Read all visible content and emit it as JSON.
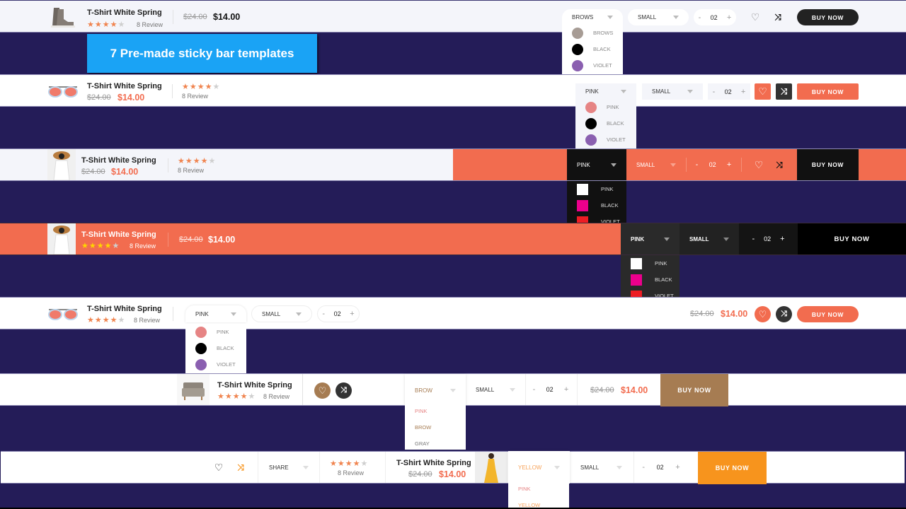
{
  "banner": {
    "text": "7 Pre-made sticky bar templates"
  },
  "product": {
    "title": "T-Shirt White Spring",
    "old_price": "$24.00",
    "new_price": "$14.00",
    "rating": 4,
    "rating_max": 5,
    "reviews": "8 Review"
  },
  "common": {
    "buy_label": "BUY NOW",
    "size_label": "SMALL",
    "qty_value": "02",
    "minus": "-",
    "plus": "+",
    "share_label": "SHARE"
  },
  "bars": [
    {
      "id": 1,
      "thumbnail": "ankle-boots",
      "color_selected": "BROWS",
      "color_options": [
        {
          "label": "BROWS",
          "swatch": "#a79c95"
        },
        {
          "label": "BLACK",
          "swatch": "#000000"
        },
        {
          "label": "VIOLET",
          "swatch": "#8a5fb0"
        }
      ],
      "buy_color": "#222222"
    },
    {
      "id": 2,
      "thumbnail": "sunglasses",
      "color_selected": "PINK",
      "color_options": [
        {
          "label": "PINK",
          "swatch": "#e68484"
        },
        {
          "label": "BLACK",
          "swatch": "#000000"
        },
        {
          "label": "VIOLET",
          "swatch": "#8a5fb0"
        }
      ],
      "buy_color": "#f26c4f"
    },
    {
      "id": 3,
      "thumbnail": "woman-in-hat",
      "color_selected": "PINK",
      "color_options": [
        {
          "label": "PINK",
          "swatch": "#ffffff"
        },
        {
          "label": "BLACK",
          "swatch": "#ec008c"
        },
        {
          "label": "VIOLET",
          "swatch": "#ed1c24"
        }
      ],
      "buy_color": "#111111"
    },
    {
      "id": 4,
      "thumbnail": "woman-in-hat",
      "color_selected": "PINK",
      "color_options": [
        {
          "label": "PINK",
          "swatch": "#ffffff"
        },
        {
          "label": "BLACK",
          "swatch": "#ec008c"
        },
        {
          "label": "VIOLET",
          "swatch": "#ed1c24"
        }
      ],
      "buy_color": "#000000"
    },
    {
      "id": 5,
      "thumbnail": "sunglasses",
      "color_selected": "PINK",
      "color_options": [
        {
          "label": "PINK",
          "swatch": "#e68484"
        },
        {
          "label": "BLACK",
          "swatch": "#000000"
        },
        {
          "label": "VIOLET",
          "swatch": "#8a5fb0"
        }
      ],
      "buy_color": "#f26c4f"
    },
    {
      "id": 6,
      "thumbnail": "armchair",
      "color_selected": "BROW",
      "color_options": [
        {
          "label": "PINK",
          "text_color": "#e68484"
        },
        {
          "label": "BROW",
          "text_color": "#a67c52"
        },
        {
          "label": "GRAY",
          "text_color": "#777777"
        }
      ],
      "buy_color": "#a67c52"
    },
    {
      "id": 7,
      "thumbnail": "yellow-dress",
      "color_selected": "YELLOW",
      "color_options": [
        {
          "label": "PINK",
          "text_color": "#e68484"
        },
        {
          "label": "YELLOW",
          "text_color": "#f7941d"
        }
      ],
      "buy_color": "#f7941d"
    }
  ],
  "colors": {
    "background": "#241c58",
    "accent_orange": "#f26c4f",
    "accent_brown": "#a67c52",
    "accent_yellow": "#f7941d",
    "banner_blue": "#1aa3f5"
  }
}
